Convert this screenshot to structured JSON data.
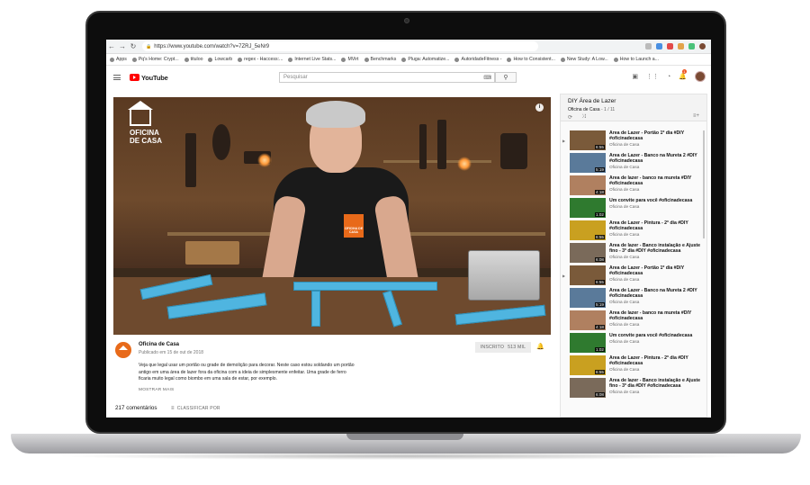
{
  "browser": {
    "url": "https://www.youtube.com/watch?v=7ZRJ_5eNr9",
    "bookmarks": [
      "Apps",
      "Pq's Home: Crypt...",
      "tituloo",
      "Lowcarb",
      "regex - Haccess:...",
      "Internet Live Stats...",
      "MVirt",
      "Benchmarks",
      "Pluga: Automatize...",
      "AutoridadeFitness -",
      "How to Consistent...",
      "New Study: A Low...",
      "How to Launch a..."
    ]
  },
  "header": {
    "logo_text": "YouTube",
    "search_placeholder": "Pesquisar",
    "notification_count": "1"
  },
  "video": {
    "watermark_line1": "OFICINA",
    "watermark_line2": "DE CASA",
    "shirt_logo": "OFICINA DE CASA",
    "info_label": "i"
  },
  "channel": {
    "name": "Oficina de Casa",
    "published": "Publicado em 15 de out de 2018",
    "subscribe_label": "INSCRITO",
    "subscriber_count": "513 MIL"
  },
  "description": {
    "text": "Veja que legal usar um portão ou grade de demolição para decorar. Neste caso estou soldando um portão antigo em uma área de lazer fora da oficina com a ideia de simplesmente enfeitar. Uma grade de ferro ficaria muito legal como biombo em uma sala de estar, por exemplo.",
    "show_more": "MOSTRAR MAIS"
  },
  "comments": {
    "count_label": "217 comentários",
    "sort_label": "CLASSIFICAR POR"
  },
  "playlist": {
    "title": "DIY Área de Lazer",
    "channel": "Oficina de Casa",
    "position": "1 / 11",
    "items": [
      {
        "title": "Área de Lazer - Portão 1º dia #DIY #oficinadecasa",
        "channel": "Oficina de Casa",
        "duration": "6:55",
        "thumb_color": "#7a5a3a",
        "arrow": "▶"
      },
      {
        "title": "Área de Lazer - Banco na Mureta 2 #DIY #oficinadecasa",
        "channel": "Oficina de Casa",
        "duration": "5:19",
        "thumb_color": "#5a7a9a",
        "arrow": ""
      },
      {
        "title": "Área de lazer - banco na mureta #DIY #oficinadecasa",
        "channel": "Oficina de Casa",
        "duration": "4:18",
        "thumb_color": "#b08060",
        "arrow": ""
      },
      {
        "title": "Um convite para você #oficinadecasa",
        "channel": "Oficina de Casa",
        "duration": "1:02",
        "thumb_color": "#2f7a2f",
        "arrow": ""
      },
      {
        "title": "Área de Lazer - Pintura - 2ª dia #DIY #oficinadecasa",
        "channel": "Oficina de Casa",
        "duration": "6:55",
        "thumb_color": "#c9a020",
        "arrow": ""
      },
      {
        "title": "Área de lazer - Banco instalação e Ajuste fino - 3ª dia #DIY #oficinadecasa",
        "channel": "Oficina de Casa",
        "duration": "6:08",
        "thumb_color": "#7a6a5a",
        "arrow": ""
      },
      {
        "title": "Área de Lazer - Portão 1º dia #DIY #oficinadecasa",
        "channel": "Oficina de Casa",
        "duration": "6:55",
        "thumb_color": "#7a5a3a",
        "arrow": "▶"
      },
      {
        "title": "Área de Lazer - Banco na Mureta 2 #DIY #oficinadecasa",
        "channel": "Oficina de Casa",
        "duration": "5:19",
        "thumb_color": "#5a7a9a",
        "arrow": ""
      },
      {
        "title": "Área de lazer - banco na mureta #DIY #oficinadecasa",
        "channel": "Oficina de Casa",
        "duration": "4:18",
        "thumb_color": "#b08060",
        "arrow": ""
      },
      {
        "title": "Um convite para você #oficinadecasa",
        "channel": "Oficina de Casa",
        "duration": "1:02",
        "thumb_color": "#2f7a2f",
        "arrow": ""
      },
      {
        "title": "Área de Lazer - Pintura - 2ª dia #DIY #oficinadecasa",
        "channel": "Oficina de Casa",
        "duration": "6:55",
        "thumb_color": "#c9a020",
        "arrow": ""
      },
      {
        "title": "Área de lazer - Banco instalação e Ajuste fino - 3ª dia #DIY #oficinadecasa",
        "channel": "Oficina de Casa",
        "duration": "6:08",
        "thumb_color": "#7a6a5a",
        "arrow": ""
      }
    ]
  },
  "colors": {
    "youtube_red": "#ff0000",
    "brand_orange": "#e86a1a",
    "project_blue": "#4fb5e0"
  }
}
